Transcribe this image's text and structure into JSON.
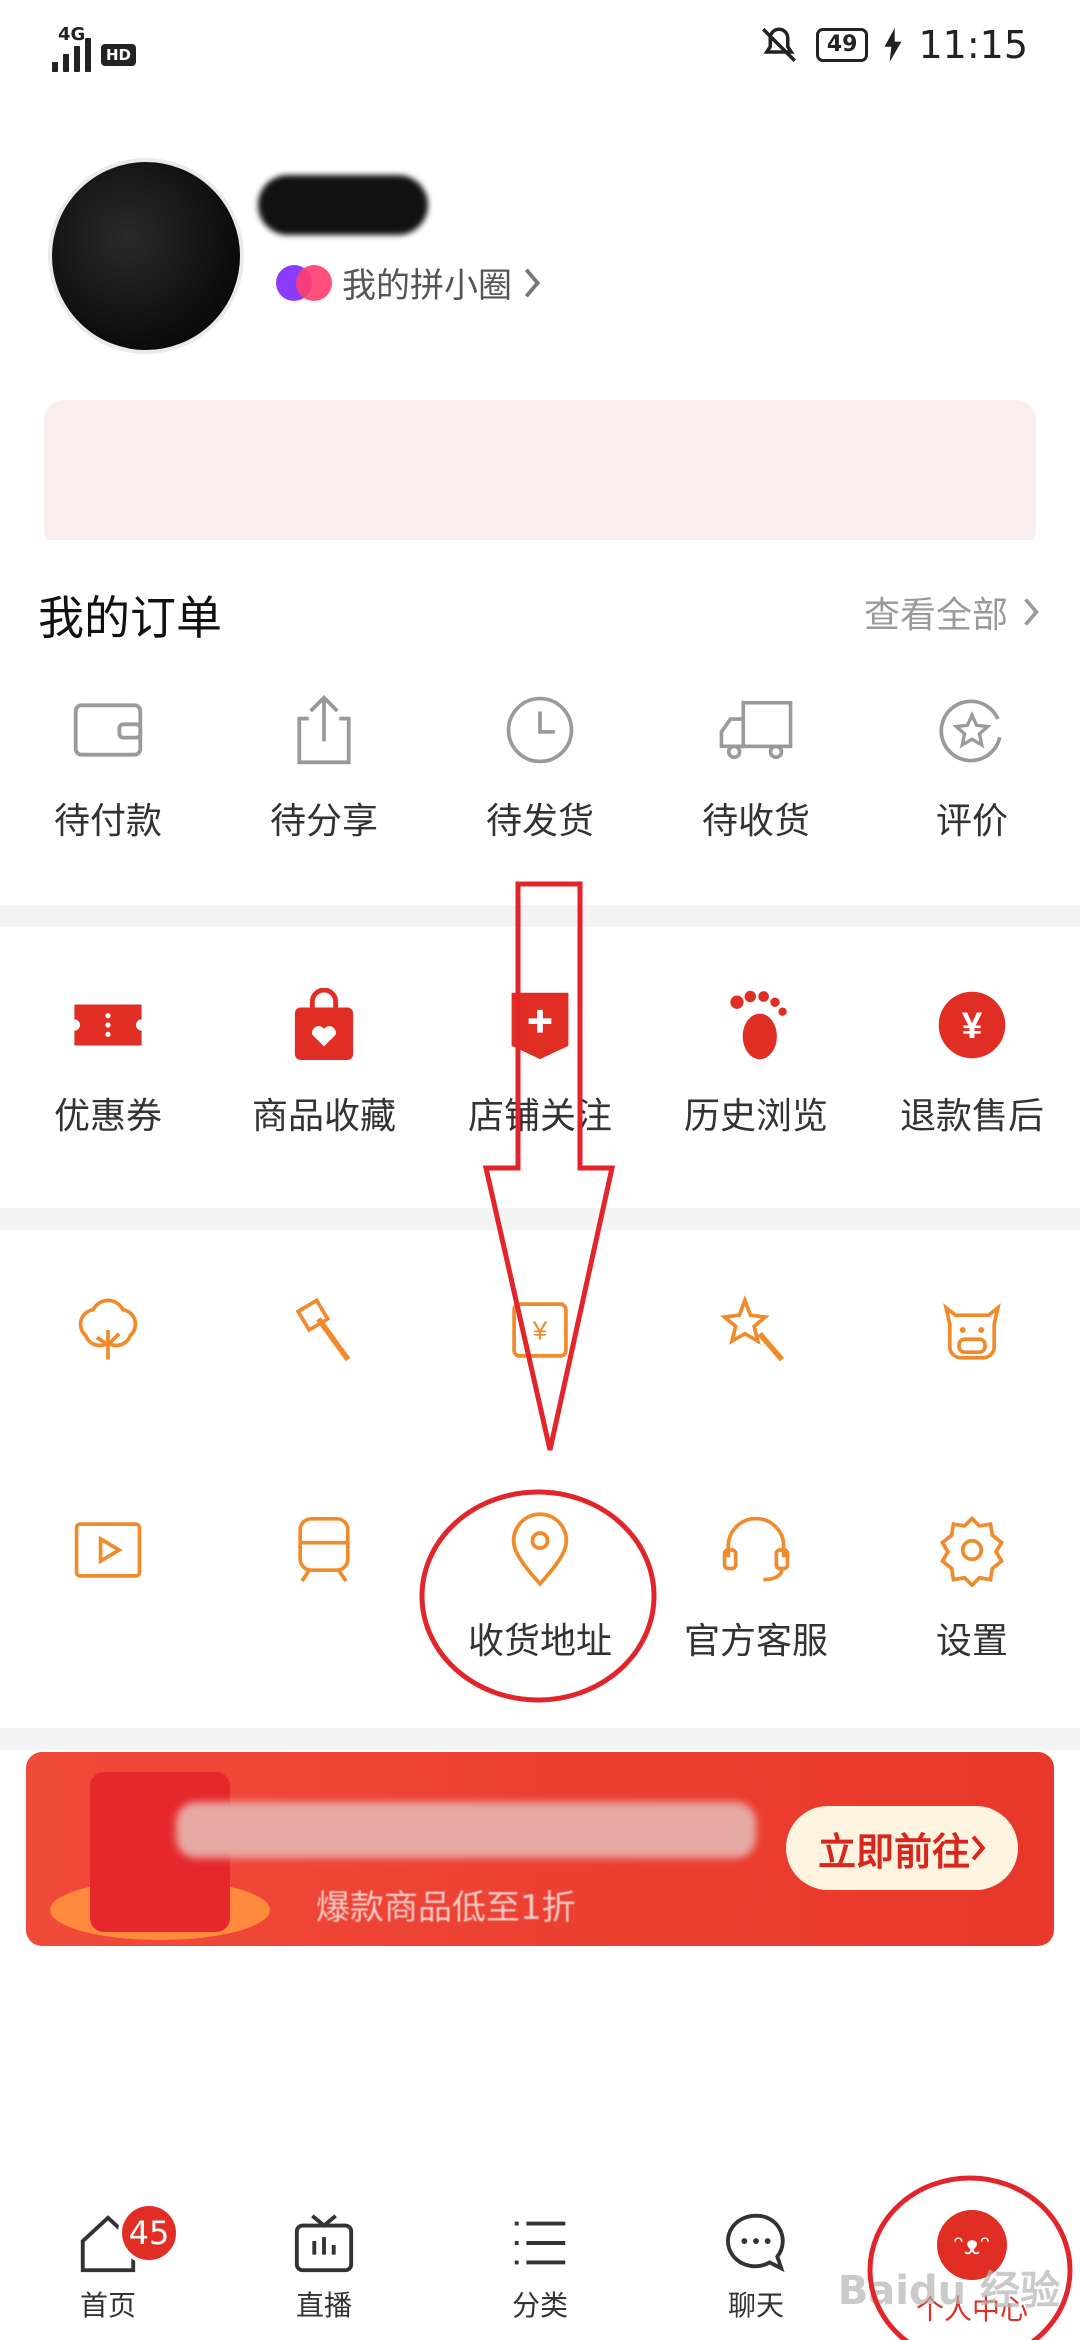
{
  "status_bar": {
    "network": "4G",
    "hd": "HD",
    "battery": "49",
    "time": "11:15"
  },
  "profile": {
    "circle_label": "我的拼小圈"
  },
  "orders": {
    "title": "我的订单",
    "view_all": "查看全部",
    "items": [
      {
        "label": "待付款",
        "icon": "wallet-icon"
      },
      {
        "label": "待分享",
        "icon": "share-icon"
      },
      {
        "label": "待发货",
        "icon": "clock-icon"
      },
      {
        "label": "待收货",
        "icon": "truck-icon"
      },
      {
        "label": "评价",
        "icon": "review-star-icon"
      }
    ]
  },
  "services": {
    "items": [
      {
        "label": "优惠券",
        "icon": "coupon-icon"
      },
      {
        "label": "商品收藏",
        "icon": "favorite-bag-icon"
      },
      {
        "label": "店铺关注",
        "icon": "store-follow-icon"
      },
      {
        "label": "历史浏览",
        "icon": "footprint-icon"
      },
      {
        "label": "退款售后",
        "icon": "refund-icon"
      }
    ]
  },
  "tools": {
    "row1": [
      {
        "icon": "tree-icon"
      },
      {
        "icon": "axe-icon"
      },
      {
        "icon": "money-bag-icon"
      },
      {
        "icon": "star-wand-icon"
      },
      {
        "icon": "cow-icon"
      }
    ],
    "row2": [
      {
        "label": "",
        "icon": "video-icon"
      },
      {
        "label": "",
        "icon": "train-icon"
      },
      {
        "label": "收货地址",
        "icon": "location-pin-icon"
      },
      {
        "label": "官方客服",
        "icon": "headset-icon"
      },
      {
        "label": "设置",
        "icon": "gear-icon"
      }
    ]
  },
  "banner": {
    "subtitle": "爆款商品低至1折",
    "button": "立即前往"
  },
  "bottom_nav": {
    "items": [
      {
        "label": "首页",
        "icon": "home-icon",
        "badge": "45"
      },
      {
        "label": "直播",
        "icon": "tv-icon"
      },
      {
        "label": "分类",
        "icon": "list-icon"
      },
      {
        "label": "聊天",
        "icon": "chat-icon"
      },
      {
        "label": "个人中心",
        "icon": "profile-icon"
      }
    ]
  },
  "watermark": "Baidu 经验",
  "colors": {
    "brand_red": "#e02e24",
    "accent_orange": "#f08a2b",
    "icon_gray": "#9a9a9a"
  }
}
